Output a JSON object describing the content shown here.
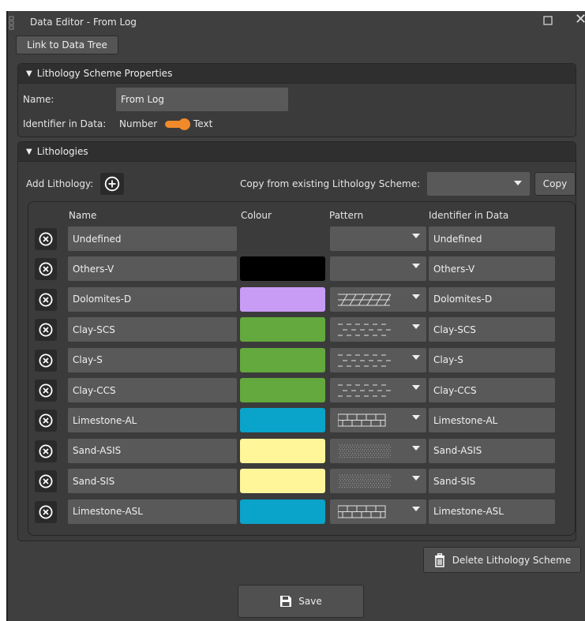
{
  "window": {
    "title": "Data Editor - From Log"
  },
  "toolbar": {
    "link_label": "Link to Data Tree"
  },
  "scheme_panel": {
    "header": "Lithology Scheme Properties",
    "name_label": "Name:",
    "name_value": "From Log",
    "identifier_label": "Identifier in Data:",
    "toggle_left": "Number",
    "toggle_right": "Text",
    "toggle_state": "Text"
  },
  "lithologies_panel": {
    "header": "Lithologies",
    "add_label": "Add Lithology:",
    "copy_from_label": "Copy from existing Lithology Scheme:",
    "copy_button": "Copy",
    "columns": {
      "name": "Name",
      "colour": "Colour",
      "pattern": "Pattern",
      "identifier": "Identifier in Data"
    },
    "rows": [
      {
        "name": "Undefined",
        "colour": "",
        "pattern": "none",
        "identifier": "Undefined"
      },
      {
        "name": "Others-V",
        "colour": "#000000",
        "pattern": "none",
        "identifier": "Others-V"
      },
      {
        "name": "Dolomites-D",
        "colour": "#c89bf5",
        "pattern": "dolomite",
        "identifier": "Dolomites-D"
      },
      {
        "name": "Clay-SCS",
        "colour": "#63a93d",
        "pattern": "clay",
        "identifier": "Clay-SCS"
      },
      {
        "name": "Clay-S",
        "colour": "#63a93d",
        "pattern": "clay",
        "identifier": "Clay-S"
      },
      {
        "name": "Clay-CCS",
        "colour": "#63a93d",
        "pattern": "clay",
        "identifier": "Clay-CCS"
      },
      {
        "name": "Limestone-AL",
        "colour": "#0aa3c9",
        "pattern": "limestone",
        "identifier": "Limestone-AL"
      },
      {
        "name": "Sand-ASIS",
        "colour": "#fff599",
        "pattern": "sand",
        "identifier": "Sand-ASIS"
      },
      {
        "name": "Sand-SIS",
        "colour": "#fff599",
        "pattern": "sand",
        "identifier": "Sand-SIS"
      },
      {
        "name": "Limestone-ASL",
        "colour": "#0aa3c9",
        "pattern": "limestone",
        "identifier": "Limestone-ASL"
      }
    ]
  },
  "footer": {
    "delete_label": "Delete Lithology Scheme",
    "save_label": "Save"
  }
}
